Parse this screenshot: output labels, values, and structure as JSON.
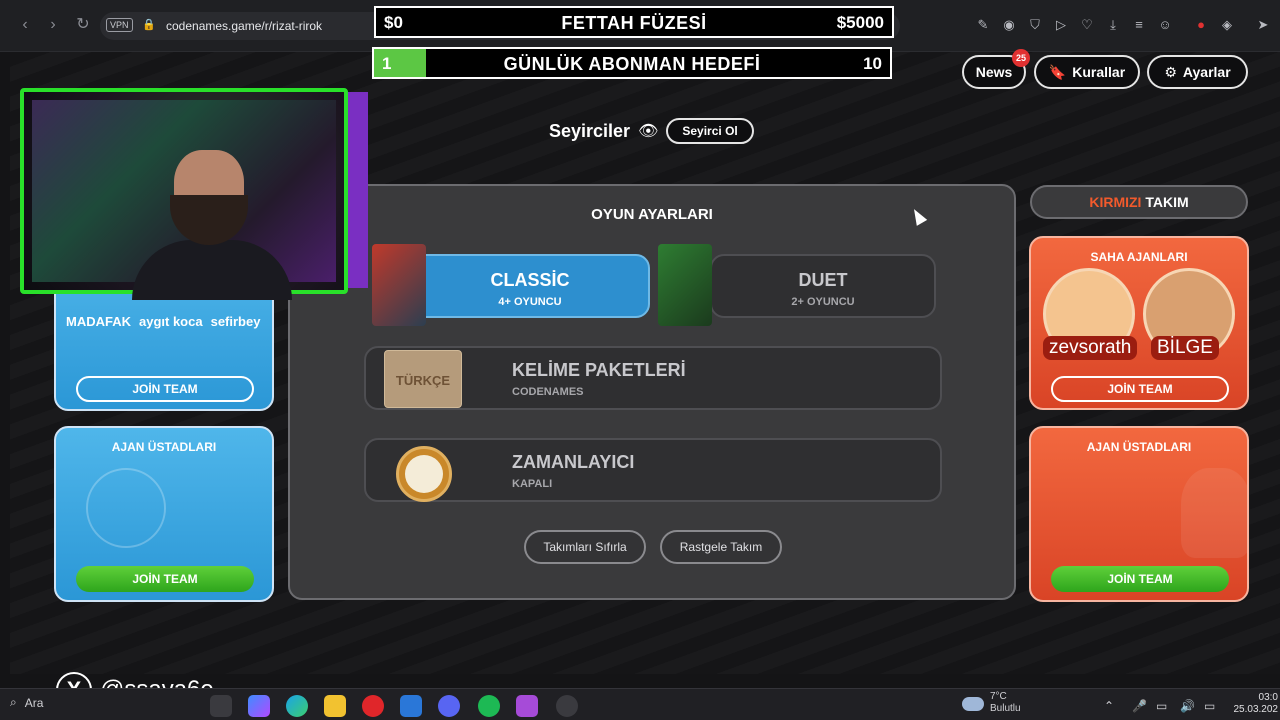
{
  "browser": {
    "vpn": "VPN",
    "url": "codenames.game/r/rizat-rirok"
  },
  "stream_goal": {
    "left": "$0",
    "title": "FETTAH FÜZESİ",
    "right": "$5000"
  },
  "sub_goal": {
    "current": "1",
    "title": "GÜNLÜK ABONMAN HEDEFİ",
    "target": "10",
    "progress": 0.1
  },
  "header_buttons": {
    "news": "News",
    "news_badge": "25",
    "rules": "Kurallar",
    "settings": "Ayarlar"
  },
  "spectators": {
    "label": "Seyirciler",
    "button": "Seyirci Ol"
  },
  "settings_panel": {
    "title": "OYUN AYARLARI",
    "classic": {
      "title": "CLASSİC",
      "subtitle": "4+ OYUNCU"
    },
    "duet": {
      "title": "DUET",
      "subtitle": "2+ OYUNCU"
    },
    "word_packs": {
      "title": "KELİME PAKETLERİ",
      "subtitle": "CODENAMES",
      "box_label": "TÜRKÇE"
    },
    "timer": {
      "title": "ZAMANLAYICI",
      "subtitle": "KAPALI"
    },
    "reset_teams": "Takımları Sıfırla",
    "random_team": "Rastgele Takım"
  },
  "blue_team": {
    "players": [
      "MADAFAK",
      "aygıt koca",
      "sefirbey"
    ],
    "join_operatives": "JOİN TEAM",
    "spymasters_title": "AJAN ÜSTADLARI",
    "join_spymasters": "JOİN TEAM"
  },
  "red_team": {
    "header_red": "KIRMIZI",
    "header_rest": "TAKIM",
    "operatives_title": "SAHA AJANLARI",
    "players": [
      "zevsorath",
      "BİLGE"
    ],
    "join_operatives": "JOİN TEAM",
    "spymasters_title": "AJAN ÜSTADLARI",
    "join_spymasters": "JOİN TEAM"
  },
  "overlay": {
    "x_letter": "X",
    "handle": "@ssava6e"
  },
  "taskbar": {
    "search": "Ara",
    "temp": "7°C",
    "weather": "Bulutlu",
    "time": "03:0",
    "date": "25.03.202"
  },
  "colors": {
    "blue": "#2b97d6",
    "red": "#d94426",
    "green": "#2ea51c",
    "webcam_frame": "#29e02a"
  }
}
